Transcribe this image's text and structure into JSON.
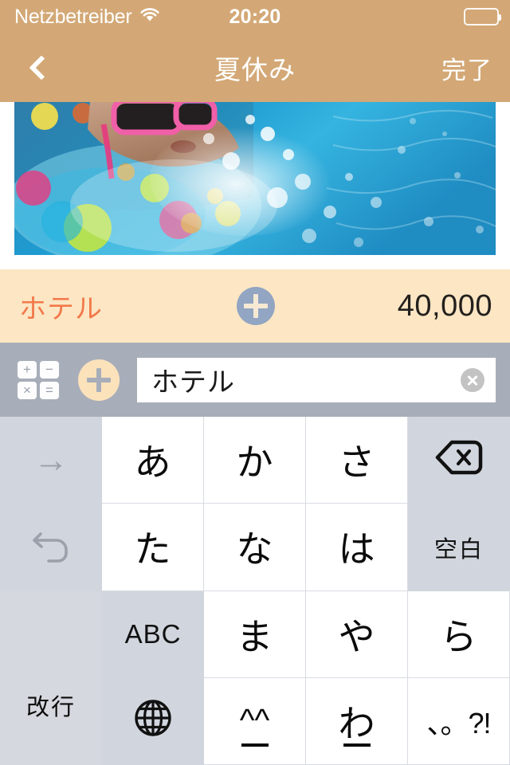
{
  "status_bar": {
    "carrier": "Netzbetreiber",
    "wifi_icon": "wifi-icon",
    "time": "20:20",
    "battery_icon": "battery-icon"
  },
  "nav_bar": {
    "back_icon": "chevron-left-icon",
    "title": "夏休み",
    "done_label": "完了",
    "background_color": "#d3a876"
  },
  "hero": {
    "photo_description": "child-in-pool-photo"
  },
  "entry_row": {
    "label": "ホテル",
    "add_icon": "plus-circle-icon",
    "amount": "40,000",
    "background_color": "#fce6c4",
    "label_color": "#f2794a"
  },
  "input_bar": {
    "calculator_icon": "calculator-icon",
    "calculator_symbols": [
      "+",
      "−",
      "×",
      "="
    ],
    "add_icon": "plus-circle-icon",
    "field_value": "ホテル",
    "field_placeholder": "",
    "clear_icon": "clear-circle-icon",
    "background_color": "#a8aeb9"
  },
  "keyboard": {
    "type": "japanese-kana-10key",
    "rows": [
      [
        {
          "name": "key-next-candidate",
          "label": "→",
          "kind": "fn-dim",
          "icon": "arrow-right-icon"
        },
        {
          "name": "key-a",
          "label": "あ",
          "kind": "char"
        },
        {
          "name": "key-ka",
          "label": "か",
          "kind": "char"
        },
        {
          "name": "key-sa",
          "label": "さ",
          "kind": "char"
        },
        {
          "name": "key-delete",
          "label": "",
          "kind": "fn",
          "icon": "backspace-icon"
        }
      ],
      [
        {
          "name": "key-undo",
          "label": "↺",
          "kind": "fn-dim",
          "icon": "undo-icon"
        },
        {
          "name": "key-ta",
          "label": "た",
          "kind": "char"
        },
        {
          "name": "key-na",
          "label": "な",
          "kind": "char"
        },
        {
          "name": "key-ha",
          "label": "は",
          "kind": "char"
        },
        {
          "name": "key-space",
          "label": "空白",
          "kind": "fn"
        }
      ],
      [
        {
          "name": "key-abc",
          "label": "ABC",
          "kind": "fn"
        },
        {
          "name": "key-ma",
          "label": "ま",
          "kind": "char"
        },
        {
          "name": "key-ya",
          "label": "や",
          "kind": "char"
        },
        {
          "name": "key-ra",
          "label": "ら",
          "kind": "char"
        },
        {
          "name": "key-return",
          "label": "改行",
          "kind": "return"
        }
      ],
      [
        {
          "name": "key-globe",
          "label": "",
          "kind": "fn",
          "icon": "globe-icon"
        },
        {
          "name": "key-emoticon",
          "label": "^^",
          "kind": "char-emoji"
        },
        {
          "name": "key-wa",
          "label": "わ",
          "kind": "char-underscore"
        },
        {
          "name": "key-punctuation",
          "label": "、。?!",
          "kind": "char-punct"
        }
      ]
    ],
    "key_background": "#ffffff",
    "fn_background": "#d1d5de"
  }
}
